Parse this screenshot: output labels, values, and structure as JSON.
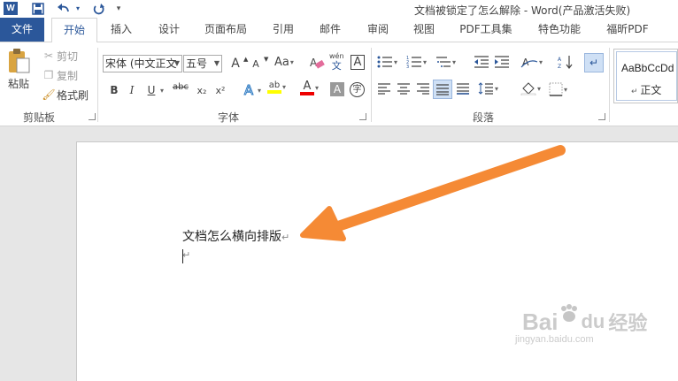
{
  "window": {
    "title": "文档被锁定了怎么解除 - Word(产品激活失败)",
    "app_icon": "W"
  },
  "quick_access": [
    "save-icon",
    "undo-icon",
    "redo-icon",
    "customize-icon"
  ],
  "tabs": [
    {
      "label": "文件"
    },
    {
      "label": "开始"
    },
    {
      "label": "插入"
    },
    {
      "label": "设计"
    },
    {
      "label": "页面布局"
    },
    {
      "label": "引用"
    },
    {
      "label": "邮件"
    },
    {
      "label": "审阅"
    },
    {
      "label": "视图"
    },
    {
      "label": "PDF工具集"
    },
    {
      "label": "特色功能"
    },
    {
      "label": "福昕PDF"
    }
  ],
  "clipboard": {
    "paste": "粘贴",
    "cut": "剪切",
    "copy": "复制",
    "format_painter": "格式刷",
    "group_label": "剪贴板"
  },
  "font": {
    "font_name": "宋体 (中文正文",
    "font_size": "五号",
    "group_label": "字体",
    "bold": "B",
    "italic": "I",
    "underline": "U",
    "strike": "abc",
    "subscript": "x₂",
    "superscript": "x²",
    "grow": "A",
    "shrink": "A",
    "case": "Aa",
    "phonetic_top": "wén",
    "phonetic_bottom": "文",
    "border_char": "A",
    "effects": "A",
    "highlight": "ab",
    "font_color": "A",
    "shading": "A",
    "enclose": "字"
  },
  "paragraph": {
    "group_label": "段落"
  },
  "styles": {
    "preview": "AaBbCcDd",
    "name": "正文"
  },
  "document": {
    "line1": "文档怎么横向排版",
    "para_mark": "↵"
  },
  "watermark": {
    "line1": "Bai",
    "line2": "du",
    "line3": "经验",
    "url": "jingyan.baidu.com"
  },
  "colors": {
    "accent": "#2b579a",
    "arrow": "#f58a35",
    "highlight_yellow": "#ffff00",
    "font_red": "#ff0000"
  }
}
